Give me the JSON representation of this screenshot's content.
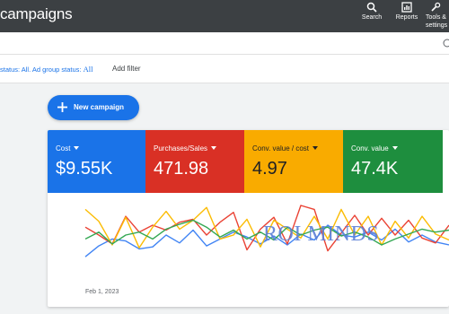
{
  "app": {
    "title": "campaigns"
  },
  "toolbar": [
    {
      "label": "Search",
      "icon": "search-icon"
    },
    {
      "label": "Reports",
      "icon": "reports-icon"
    },
    {
      "label": "Tools & settings",
      "icon": "tools-icon"
    }
  ],
  "filters": {
    "status_prefix": "status: All",
    "ad_group_status": "Ad group status: ",
    "ad_group_value": "All",
    "add_filter": "Add filter"
  },
  "new_campaign": {
    "label": "New campaign"
  },
  "metrics": [
    {
      "name": "Cost",
      "value": "$9.55K",
      "color": "#1a73e8"
    },
    {
      "name": "Purchases/Sales",
      "value": "471.98",
      "color": "#d93025"
    },
    {
      "name": "Conv. value / cost",
      "value": "4.97",
      "color": "#f9ab00"
    },
    {
      "name": "Conv. value",
      "value": "47.4K",
      "color": "#1e8e3e"
    }
  ],
  "chart_data": {
    "type": "line",
    "x_start_label": "Feb 1, 2023",
    "series": [
      {
        "metric": "Cost",
        "color": "#4285f4",
        "values": [
          8,
          19,
          26,
          24,
          16,
          18,
          30,
          22,
          35,
          19,
          26,
          33,
          28,
          21,
          29,
          20,
          31,
          25,
          40,
          30,
          28,
          33,
          25,
          36,
          23,
          30,
          23,
          20
        ]
      },
      {
        "metric": "Purchases/Sales",
        "color": "#ea4335",
        "values": [
          38,
          30,
          21,
          49,
          33,
          40,
          35,
          43,
          46,
          30,
          43,
          53,
          15,
          36,
          48,
          21,
          60,
          56,
          14,
          32,
          50,
          30,
          47,
          30,
          45,
          27,
          22,
          40
        ]
      },
      {
        "metric": "Conv. value / cost",
        "color": "#fbbc04",
        "values": [
          56,
          44,
          20,
          48,
          17,
          38,
          54,
          36,
          45,
          58,
          26,
          30,
          46,
          18,
          45,
          36,
          27,
          49,
          26,
          56,
          30,
          49,
          20,
          44,
          27,
          49,
          31,
          25
        ]
      },
      {
        "metric": "Conv. value",
        "color": "#34a853",
        "values": [
          26,
          33,
          21,
          30,
          33,
          26,
          36,
          41,
          45,
          38,
          28,
          35,
          26,
          33,
          25,
          38,
          30,
          35,
          38,
          29,
          33,
          28,
          20,
          26,
          31,
          36,
          33,
          35
        ]
      }
    ]
  },
  "watermark": "ROI MINDS"
}
